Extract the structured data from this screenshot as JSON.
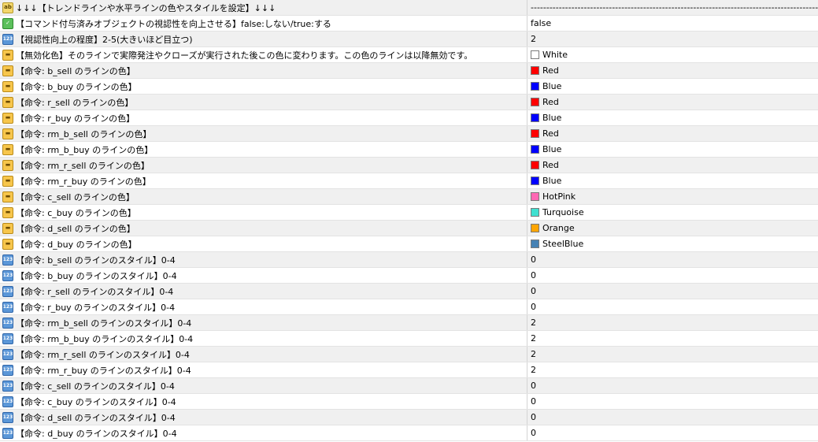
{
  "header": {
    "name": "↓↓↓【トレンドラインや水平ラインの色やスタイルを設定】↓↓↓",
    "value": "--------------------------------------------------------------------------------------------",
    "icon": "string-icon"
  },
  "rows": [
    {
      "name": "【コマンド付与済みオブジェクトの視認性を向上させる】false:しない/true:する",
      "value": "false",
      "type": "bool"
    },
    {
      "name": "【視認性向上の程度】2-5(大きいほど目立つ)",
      "value": "2",
      "type": "number"
    },
    {
      "name": "【無効化色】そのラインで実際発注やクローズが実行された後この色に変わります。この色のラインは以降無効です。",
      "value": "White",
      "type": "color",
      "color": "#ffffff"
    },
    {
      "name": "【命令: b_sell のラインの色】",
      "value": "Red",
      "type": "color",
      "color": "#ff0000"
    },
    {
      "name": "【命令: b_buy のラインの色】",
      "value": "Blue",
      "type": "color",
      "color": "#0000ff"
    },
    {
      "name": "【命令: r_sell のラインの色】",
      "value": "Red",
      "type": "color",
      "color": "#ff0000"
    },
    {
      "name": "【命令: r_buy のラインの色】",
      "value": "Blue",
      "type": "color",
      "color": "#0000ff"
    },
    {
      "name": "【命令: rm_b_sell のラインの色】",
      "value": "Red",
      "type": "color",
      "color": "#ff0000"
    },
    {
      "name": "【命令: rm_b_buy のラインの色】",
      "value": "Blue",
      "type": "color",
      "color": "#0000ff"
    },
    {
      "name": "【命令: rm_r_sell のラインの色】",
      "value": "Red",
      "type": "color",
      "color": "#ff0000"
    },
    {
      "name": "【命令: rm_r_buy のラインの色】",
      "value": "Blue",
      "type": "color",
      "color": "#0000ff"
    },
    {
      "name": "【命令: c_sell のラインの色】",
      "value": "HotPink",
      "type": "color",
      "color": "#ff69b4"
    },
    {
      "name": "【命令: c_buy のラインの色】",
      "value": "Turquoise",
      "type": "color",
      "color": "#40e0d0"
    },
    {
      "name": "【命令: d_sell のラインの色】",
      "value": "Orange",
      "type": "color",
      "color": "#ffa500"
    },
    {
      "name": "【命令: d_buy のラインの色】",
      "value": "SteelBlue",
      "type": "color",
      "color": "#4682b4"
    },
    {
      "name": "【命令: b_sell のラインのスタイル】0-4",
      "value": "0",
      "type": "number"
    },
    {
      "name": "【命令: b_buy のラインのスタイル】0-4",
      "value": "0",
      "type": "number"
    },
    {
      "name": "【命令: r_sell のラインのスタイル】0-4",
      "value": "0",
      "type": "number"
    },
    {
      "name": "【命令: r_buy のラインのスタイル】0-4",
      "value": "0",
      "type": "number"
    },
    {
      "name": "【命令: rm_b_sell のラインのスタイル】0-4",
      "value": "2",
      "type": "number"
    },
    {
      "name": "【命令: rm_b_buy のラインのスタイル】0-4",
      "value": "2",
      "type": "number"
    },
    {
      "name": "【命令: rm_r_sell のラインのスタイル】0-4",
      "value": "2",
      "type": "number"
    },
    {
      "name": "【命令: rm_r_buy のラインのスタイル】0-4",
      "value": "2",
      "type": "number"
    },
    {
      "name": "【命令: c_sell のラインのスタイル】0-4",
      "value": "0",
      "type": "number"
    },
    {
      "name": "【命令: c_buy のラインのスタイル】0-4",
      "value": "0",
      "type": "number"
    },
    {
      "name": "【命令: d_sell のラインのスタイル】0-4",
      "value": "0",
      "type": "number"
    },
    {
      "name": "【命令: d_buy のラインのスタイル】0-4",
      "value": "0",
      "type": "number"
    }
  ],
  "icons": {
    "string": {
      "glyph": "ab",
      "name": "string-icon"
    },
    "bool": {
      "glyph": "✓",
      "name": "bool-icon"
    },
    "number": {
      "glyph": "123",
      "name": "number-icon"
    },
    "color": {
      "glyph": "▬",
      "name": "color-icon"
    }
  }
}
